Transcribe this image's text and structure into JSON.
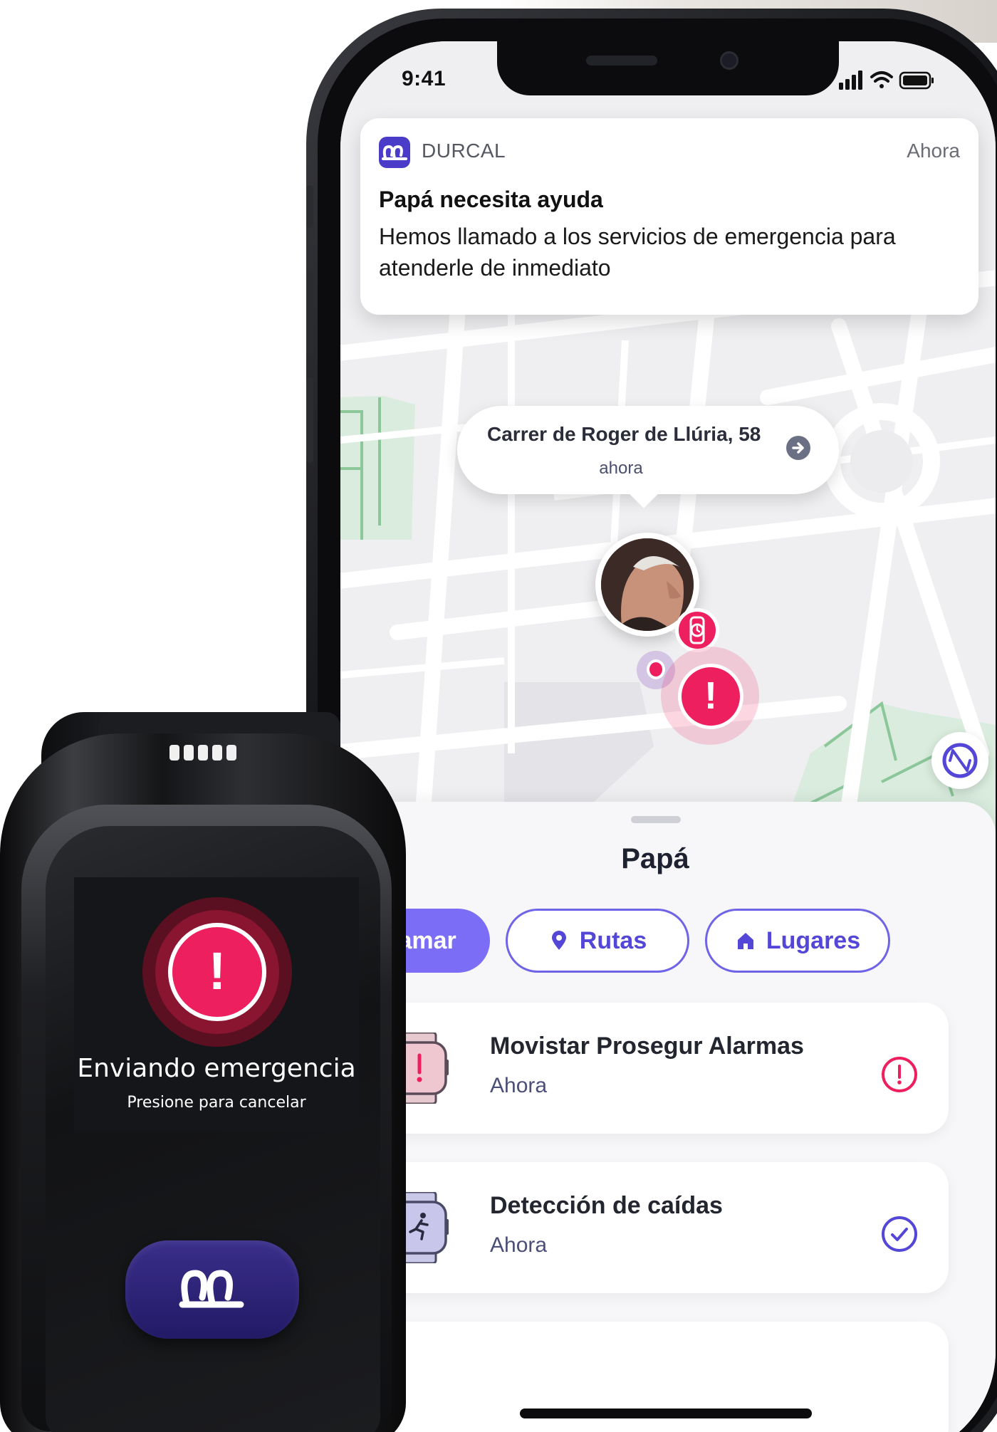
{
  "status_bar": {
    "time": "9:41"
  },
  "notification": {
    "app_name": "DURCAL",
    "time": "Ahora",
    "title": "Papá necesita ayuda",
    "body": "Hemos llamado a los servicios de emergencia para atenderle de inmediato"
  },
  "map": {
    "location_address": "Carrer de Roger de Llúria, 58",
    "location_time": "ahora"
  },
  "sheet": {
    "title": "Papá",
    "actions": [
      {
        "label": "Llamar",
        "icon": "phone-icon"
      },
      {
        "label": "Rutas",
        "icon": "map-pin-icon"
      },
      {
        "label": "Lugares",
        "icon": "home-icon"
      }
    ],
    "events": [
      {
        "title": "Movistar Prosegur Alarmas",
        "time": "Ahora",
        "status_icon": "alert-circle-icon"
      },
      {
        "title": "Detección de caídas",
        "time": "Ahora",
        "status_icon": "check-circle-icon"
      }
    ]
  },
  "watch": {
    "screen_title": "Enviando emergencia",
    "screen_subtitle": "Presione para cancelar",
    "button_icon": "durcal-logo-icon"
  },
  "colors": {
    "brand": "#4b3bc9",
    "accent": "#7b6df5",
    "alert": "#ee1f5f"
  }
}
